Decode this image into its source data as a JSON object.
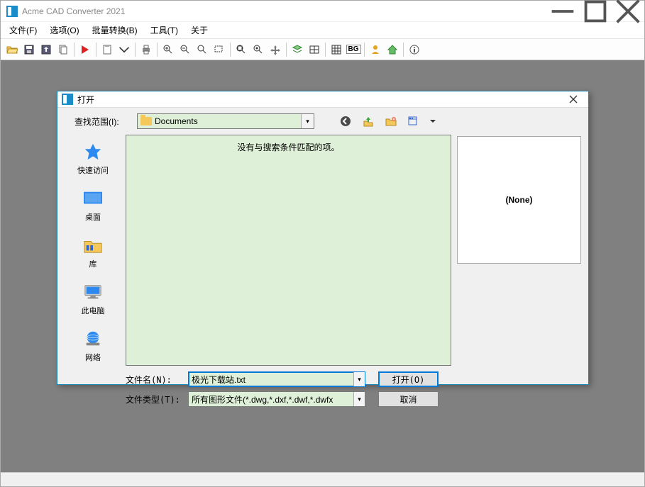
{
  "app": {
    "title": "Acme CAD Converter 2021"
  },
  "menu": {
    "file": "文件(F)",
    "options": "选项(O)",
    "batch": "批量转换(B)",
    "tools": "工具(T)",
    "about": "关于"
  },
  "toolbar": {
    "bg_label": "BG"
  },
  "dialog": {
    "title": "打开",
    "lookin_label": "查找范围(I):",
    "lookin_value": "Documents",
    "empty_msg": "没有与搜索条件匹配的项。",
    "places": {
      "quick": "快速访问",
      "desktop": "桌面",
      "libraries": "库",
      "thispc": "此电脑",
      "network": "网络"
    },
    "filename_label": "文件名(N):",
    "filename_value": "极光下载站.txt",
    "filetype_label": "文件类型(T):",
    "filetype_value": "所有图形文件(*.dwg,*.dxf,*.dwf,*.dwfx",
    "open_btn": "打开(O)",
    "cancel_btn": "取消",
    "preview_text": "(None)"
  }
}
